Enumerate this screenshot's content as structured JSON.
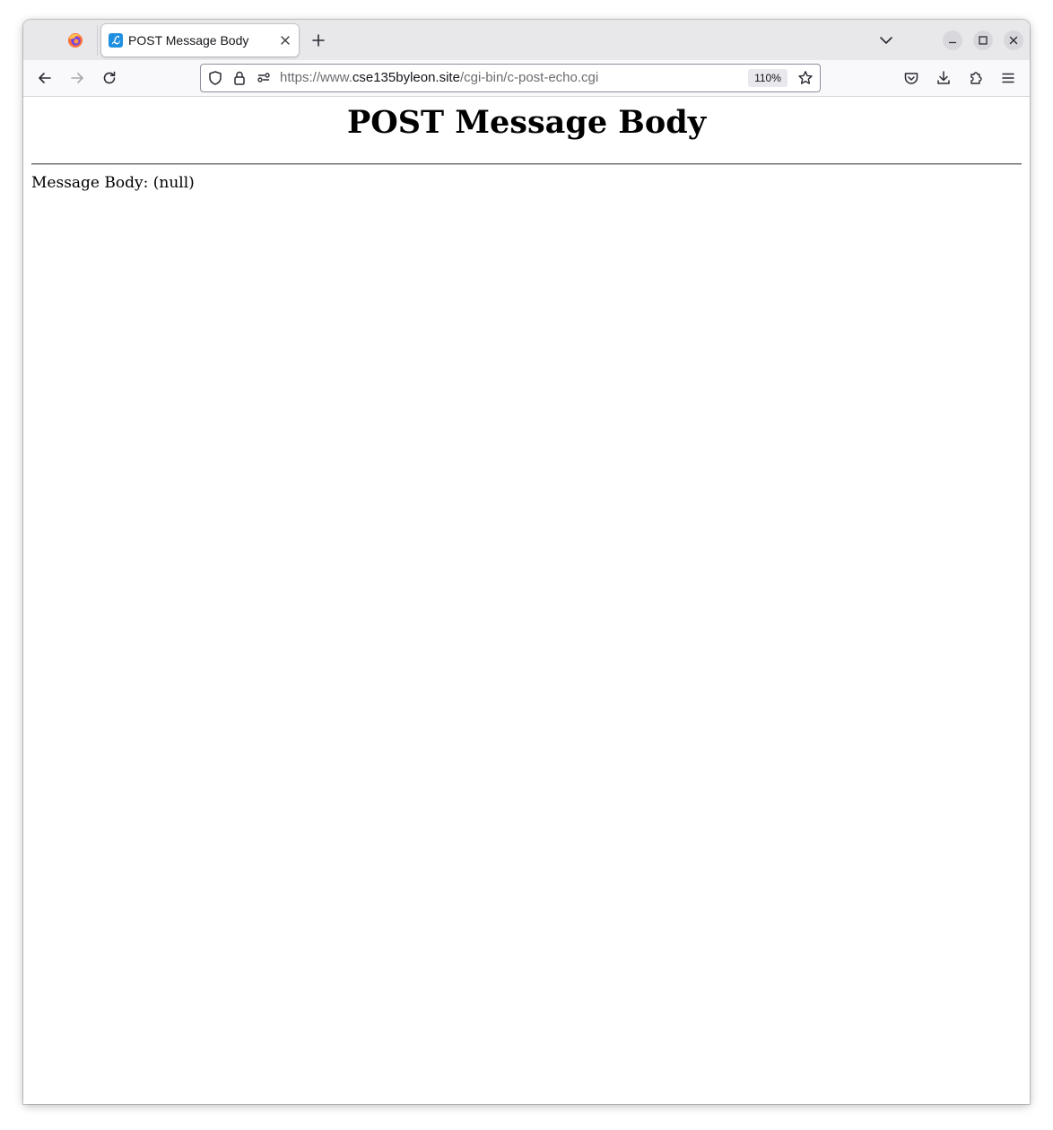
{
  "browser": {
    "tab": {
      "title": "POST Message Body",
      "favicon_glyph": "ℒ",
      "favicon_color": "#1f8fe0"
    },
    "urlbar": {
      "url_prefix": "https://www.",
      "url_host": "cse135byleon.site",
      "url_path": "/cgi-bin/c-post-echo.cgi",
      "zoom": "110%"
    },
    "icons": {
      "app": "firefox-icon",
      "tab_close": "close-icon",
      "new_tab": "plus-icon",
      "list_tabs": "chevron-down-icon",
      "minimize": "minimize-icon",
      "maximize": "maximize-icon",
      "close_window": "close-icon",
      "back": "back-arrow-icon",
      "forward": "forward-arrow-icon",
      "reload": "reload-icon",
      "tracking_protection": "shield-icon",
      "secure": "lock-icon",
      "permissions": "permissions-icon",
      "bookmark": "star-icon",
      "pocket": "pocket-icon",
      "downloads": "download-icon",
      "extensions": "puzzle-icon",
      "menu": "hamburger-menu-icon"
    }
  },
  "page": {
    "heading": "POST Message Body",
    "body_text": "Message Body: (null)"
  }
}
